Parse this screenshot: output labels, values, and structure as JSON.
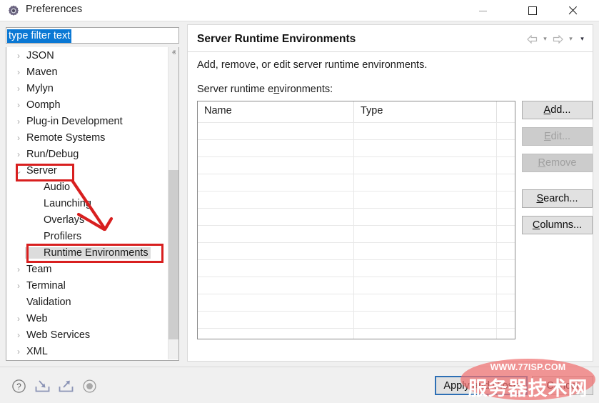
{
  "window": {
    "title": "Preferences",
    "icon": "gear-icon",
    "controls": {
      "minimize": "—",
      "maximize": "□",
      "close": "✕"
    }
  },
  "filter": {
    "value": "type filter text",
    "placeholder": "type filter text"
  },
  "tree": {
    "items": [
      {
        "label": "JSON",
        "expandable": true,
        "expanded": false,
        "child": false,
        "selected": false
      },
      {
        "label": "Maven",
        "expandable": true,
        "expanded": false,
        "child": false,
        "selected": false
      },
      {
        "label": "Mylyn",
        "expandable": true,
        "expanded": false,
        "child": false,
        "selected": false
      },
      {
        "label": "Oomph",
        "expandable": true,
        "expanded": false,
        "child": false,
        "selected": false
      },
      {
        "label": "Plug-in Development",
        "expandable": true,
        "expanded": false,
        "child": false,
        "selected": false
      },
      {
        "label": "Remote Systems",
        "expandable": true,
        "expanded": false,
        "child": false,
        "selected": false
      },
      {
        "label": "Run/Debug",
        "expandable": true,
        "expanded": false,
        "child": false,
        "selected": false
      },
      {
        "label": "Server",
        "expandable": true,
        "expanded": true,
        "child": false,
        "selected": false
      },
      {
        "label": "Audio",
        "expandable": false,
        "expanded": false,
        "child": true,
        "selected": false
      },
      {
        "label": "Launching",
        "expandable": false,
        "expanded": false,
        "child": true,
        "selected": false
      },
      {
        "label": "Overlays",
        "expandable": false,
        "expanded": false,
        "child": true,
        "selected": false
      },
      {
        "label": "Profilers",
        "expandable": false,
        "expanded": false,
        "child": true,
        "selected": false
      },
      {
        "label": "Runtime Environments",
        "expandable": false,
        "expanded": false,
        "child": true,
        "selected": true
      },
      {
        "label": "Team",
        "expandable": true,
        "expanded": false,
        "child": false,
        "selected": false
      },
      {
        "label": "Terminal",
        "expandable": true,
        "expanded": false,
        "child": false,
        "selected": false
      },
      {
        "label": "Validation",
        "expandable": false,
        "expanded": false,
        "child": false,
        "selected": false
      },
      {
        "label": "Web",
        "expandable": true,
        "expanded": false,
        "child": false,
        "selected": false
      },
      {
        "label": "Web Services",
        "expandable": true,
        "expanded": false,
        "child": false,
        "selected": false
      },
      {
        "label": "XML",
        "expandable": true,
        "expanded": false,
        "child": false,
        "selected": false
      }
    ],
    "glyph_collapsed": "›",
    "glyph_expanded": "⌄",
    "scrollbar": {
      "up": "ⱏ",
      "down": "ⱟ"
    }
  },
  "page": {
    "title": "Server Runtime Environments",
    "description": "Add, remove, or edit server runtime environments.",
    "list_label_pre": "Server runtime e",
    "list_label_mnemonic": "n",
    "list_label_post": "vironments:",
    "nav": {
      "back": "⇦",
      "back_menu": "▾",
      "forward": "⇨",
      "forward_menu": "▾",
      "view_menu": "▾"
    }
  },
  "table": {
    "columns": [
      "Name",
      "Type",
      ""
    ],
    "rows": [],
    "empty_row_count": 13
  },
  "side_buttons": [
    {
      "label": "Add...",
      "mnemonic": "A",
      "enabled": true
    },
    {
      "label": "Edit...",
      "mnemonic": "E",
      "enabled": false
    },
    {
      "label": "Remove",
      "mnemonic": "R",
      "enabled": false
    },
    {
      "label": "Search...",
      "mnemonic": "S",
      "enabled": true
    },
    {
      "label": "Columns...",
      "mnemonic": "C",
      "enabled": true
    }
  ],
  "footer": {
    "icons": [
      "help-icon",
      "import-icon",
      "export-icon",
      "restore-defaults-icon"
    ],
    "apply_and_close": "Apply and Close",
    "cancel": "Cancel"
  },
  "annotations": {
    "box_server": "Server",
    "box_runtime": "Runtime Environments",
    "arrow_color": "#d81f1f"
  },
  "watermark": {
    "line1": "WWW.77ISP.COM",
    "line2": "服务器技术网",
    "color": "#f07070"
  }
}
